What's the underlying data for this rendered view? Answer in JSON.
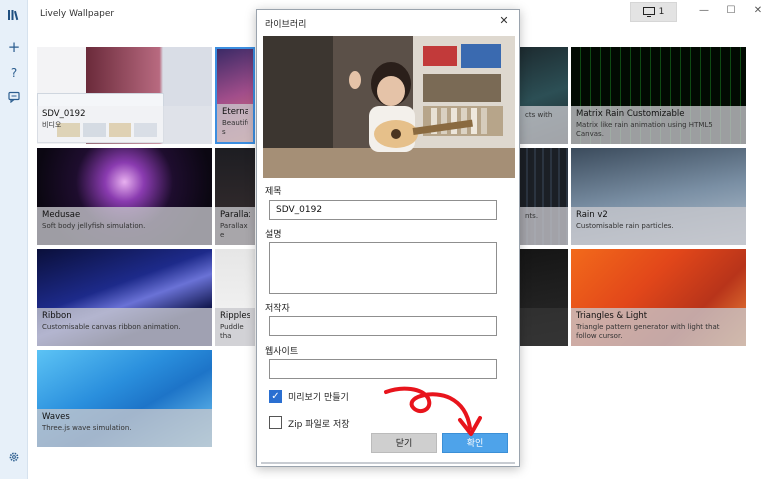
{
  "app": {
    "title": "Lively Wallpaper",
    "monitor_count": "1",
    "minimize": "—",
    "maximize": "☐",
    "close": "✕"
  },
  "rail": {
    "icons": [
      "library-icon",
      "add-icon",
      "help-icon",
      "feedback-icon",
      "settings-icon"
    ]
  },
  "tiles": [
    {
      "title": "SDV_0192",
      "desc": "비디오"
    },
    {
      "title": "Eternal L",
      "desc": "Beautiful s"
    },
    {
      "title": "",
      "desc": "cts with"
    },
    {
      "title": "Matrix Rain Customizable",
      "desc": "Matrix like rain animation using HTML5 Canvas."
    },
    {
      "title": "Medusae",
      "desc": "Soft body jellyfish simulation."
    },
    {
      "title": "Parallax.js",
      "desc": "Parallax e"
    },
    {
      "title": "",
      "desc": "nts."
    },
    {
      "title": "Rain v2",
      "desc": "Customisable rain particles."
    },
    {
      "title": "Ribbon",
      "desc": "Customisable canvas ribbon animation."
    },
    {
      "title": "Ripples",
      "desc": "Puddle tha"
    },
    {
      "title": "",
      "desc": ""
    },
    {
      "title": "Triangles & Light",
      "desc": "Triangle pattern generator with light that follow cursor."
    },
    {
      "title": "Waves",
      "desc": "Three.js wave simulation."
    }
  ],
  "dialog": {
    "title": "라이브러리",
    "title_label": "제목",
    "title_value": "SDV_0192",
    "desc_label": "설명",
    "desc_value": "",
    "author_label": "저작자",
    "author_value": "",
    "website_label": "웹사이트",
    "website_value": "",
    "preview_check_label": "미리보기 만들기",
    "preview_checked": true,
    "zip_check_label": "Zip 파일로 저장",
    "zip_checked": false,
    "close_button": "닫기",
    "ok_button": "확인"
  },
  "colors": {
    "accent": "#4ea3ea",
    "annotation_arrow": "#e8141c"
  }
}
